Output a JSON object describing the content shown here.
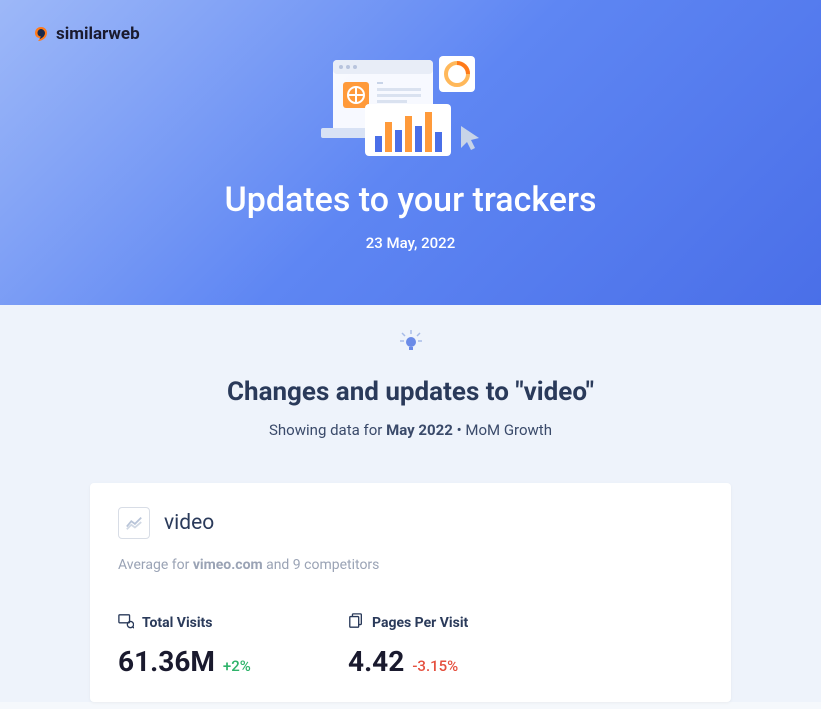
{
  "logo": {
    "text": "similarweb"
  },
  "hero": {
    "title": "Updates to your trackers",
    "date": "23 May, 2022"
  },
  "section": {
    "title": "Changes and updates to \"video\"",
    "subtitle_prefix": "Showing data for ",
    "subtitle_bold": "May 2022",
    "subtitle_suffix": " • MoM Growth"
  },
  "card": {
    "title": "video",
    "subtitle_prefix": "Average for ",
    "subtitle_bold": "vimeo.com",
    "subtitle_suffix": " and 9 competitors",
    "metrics": [
      {
        "label": "Total Visits",
        "value": "61.36M",
        "change": "+2%",
        "positive": true
      },
      {
        "label": "Pages Per Visit",
        "value": "4.42",
        "change": "-3.15%",
        "positive": false
      }
    ]
  }
}
